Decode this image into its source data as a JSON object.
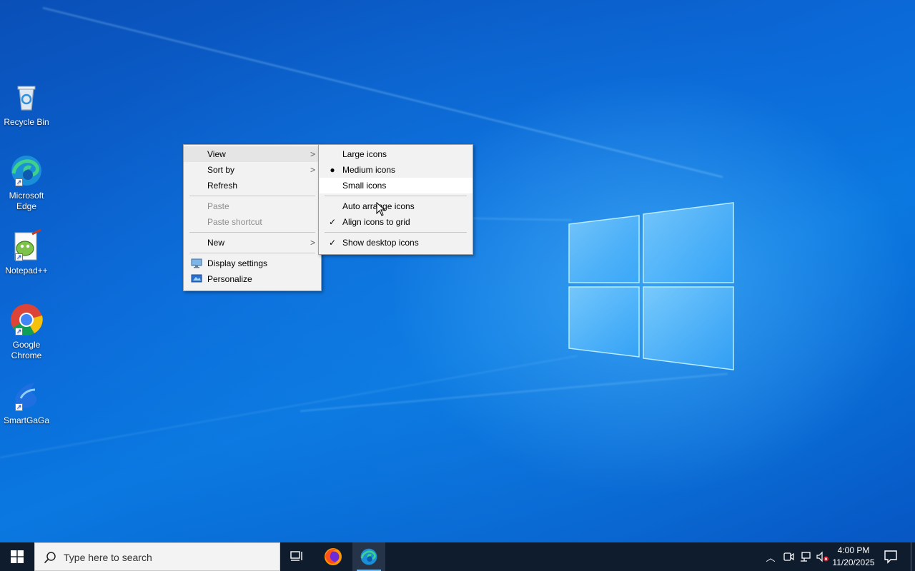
{
  "desktop": {
    "icons": [
      {
        "label": "Recycle Bin",
        "icon": "recycle-bin-icon"
      },
      {
        "label": "Microsoft Edge",
        "icon": "edge-icon"
      },
      {
        "label": "Notepad++",
        "icon": "notepad-plus-plus-icon"
      },
      {
        "label": "Google Chrome",
        "icon": "chrome-icon"
      },
      {
        "label": "SmartGaGa",
        "icon": "smartgaga-icon"
      }
    ]
  },
  "context_menu": {
    "items": [
      {
        "label": "View",
        "submenu": true
      },
      {
        "label": "Sort by",
        "submenu": true
      },
      {
        "label": "Refresh"
      },
      {
        "label": "Paste",
        "disabled": true
      },
      {
        "label": "Paste shortcut",
        "disabled": true
      },
      {
        "label": "New",
        "submenu": true
      },
      {
        "label": "Display settings",
        "icon": "display-settings-icon"
      },
      {
        "label": "Personalize",
        "icon": "personalize-icon"
      }
    ]
  },
  "view_submenu": {
    "items": [
      {
        "label": "Large icons"
      },
      {
        "label": "Medium icons",
        "selected": true
      },
      {
        "label": "Small icons"
      },
      {
        "label": "Auto arrange icons"
      },
      {
        "label": "Align icons to grid",
        "checked": true
      },
      {
        "label": "Show desktop icons",
        "checked": true
      }
    ]
  },
  "taskbar": {
    "search_placeholder": "Type here to search",
    "time": "4:00 PM",
    "date": "11/20/2025",
    "pinned": [
      "task-view-icon",
      "firefox-icon",
      "edge-icon"
    ]
  },
  "colors": {
    "taskbar": "#0f1c2e",
    "menu_bg": "#f2f2f2",
    "accent": "#76b9ed"
  }
}
